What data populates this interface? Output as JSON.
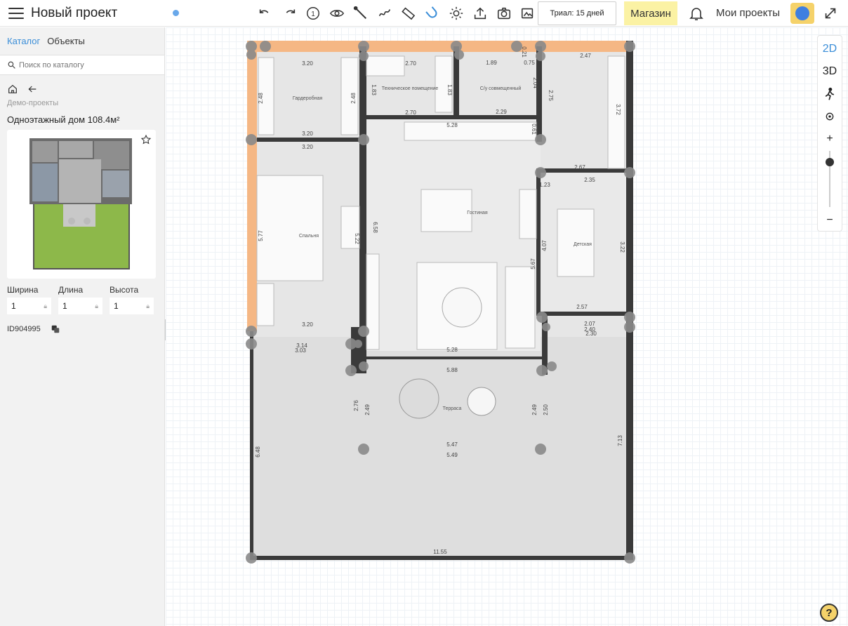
{
  "header": {
    "title": "Новый проект",
    "trial": "Триал: 15 дней",
    "shop": "Магазин",
    "my_projects": "Мои проекты",
    "step_number": "1"
  },
  "toolbar_icons": [
    "undo-icon",
    "redo-icon",
    "step-icon",
    "eye-icon",
    "wall-tool-icon",
    "draw-icon",
    "ruler-icon",
    "magnet-icon",
    "sun-icon",
    "upload-icon",
    "camera-icon",
    "render-icon"
  ],
  "sidebar": {
    "tabs": [
      "Каталог",
      "Объекты"
    ],
    "search_placeholder": "Поиск по каталогу",
    "breadcrumb": "Демо-проекты",
    "project_name": "Одноэтажный дом 108.4м²",
    "dimensions": [
      {
        "label": "Ширина",
        "value": "1"
      },
      {
        "label": "Длина",
        "value": "1"
      },
      {
        "label": "Высота",
        "value": "1"
      }
    ],
    "object_id": "ID904995"
  },
  "view": {
    "mode_2d": "2D",
    "mode_3d": "3D",
    "zoom_in": "+",
    "zoom_out": "−",
    "zoom_level": 0.85,
    "help": "?"
  },
  "plan": {
    "rooms": [
      "Гардеробная",
      "Техническое помещение",
      "С/у совмещенный",
      "Спальня",
      "Гостиная",
      "Детская",
      "Терраса"
    ],
    "dims": [
      "3.20",
      "2.70",
      "1.83",
      "1.89",
      "1.83",
      "2.47",
      "0.75",
      "0.21",
      "2.48",
      "2.48",
      "2.70",
      "2.04",
      "2.75",
      "3.72",
      "5.28",
      "2.29",
      "0.61",
      "3.20",
      "3.20",
      "2.67",
      "2.35",
      "1.23",
      "5.77",
      "6.58",
      "5.22",
      "4.07",
      "5.67",
      "3.22",
      "2.57",
      "3.20",
      "2.07",
      "2.40",
      "2.30",
      "3.14",
      "3.03",
      "5.28",
      "5.88",
      "2.76",
      "2.49",
      "2.49",
      "2.50",
      "5.47",
      "5.49",
      "6.48",
      "7.13",
      "11.55"
    ]
  }
}
